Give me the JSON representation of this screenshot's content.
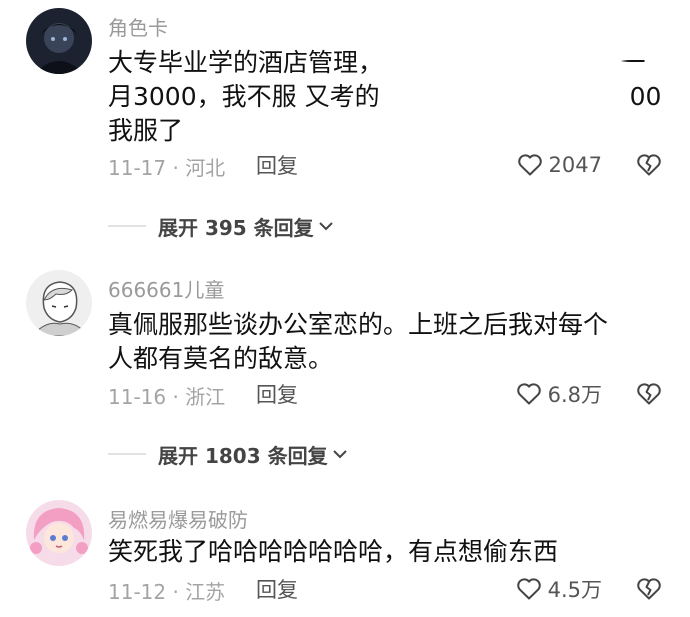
{
  "comments": [
    {
      "username": "角色卡",
      "lines": [
        "大专毕业学的酒店管理，　　　　　　　　　　一",
        "月3000，我不服 又考的　　　　　　　　　　00",
        "我服了"
      ],
      "date_location": "11-17 · 河北",
      "reply_label": "回复",
      "likes": "2047",
      "expand_label": "展开 395 条回复"
    },
    {
      "username": "666661儿童",
      "lines": [
        "真佩服那些谈办公室恋的。上班之后我对每个",
        "人都有莫名的敌意。"
      ],
      "date_location": "11-16 · 浙江",
      "reply_label": "回复",
      "likes": "6.8万",
      "expand_label": "展开 1803 条回复"
    },
    {
      "username": "易燃易爆易破防",
      "lines": [
        "笑死我了哈哈哈哈哈哈哈，有点想偷东西"
      ],
      "date_location": "11-12 · 江苏",
      "reply_label": "回复",
      "likes": "4.5万"
    }
  ],
  "icons": {
    "like": "heart-outline-icon",
    "dislike": "broken-heart-icon",
    "expand": "chevron-down-icon"
  }
}
